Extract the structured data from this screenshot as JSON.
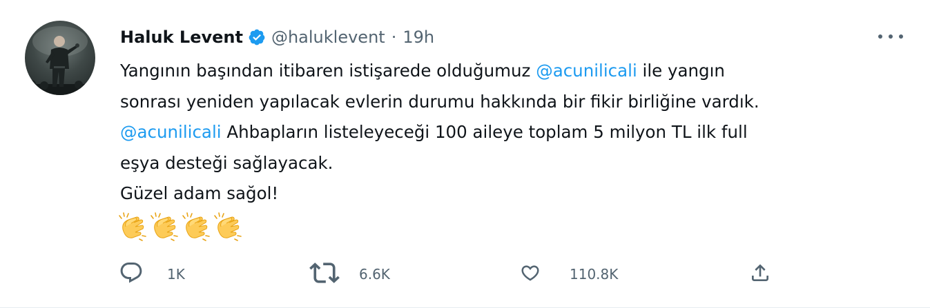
{
  "tweet": {
    "author": {
      "name": "Haluk Levent",
      "handle": "@haluklevent",
      "separator": "·",
      "time": "19h",
      "verified": true
    },
    "text": {
      "line1_pre": "Yangının başından itibaren istişarede olduğumuz  ",
      "mention1": "@acunilicali",
      "line1_post": " ile yangın",
      "line2": "sonrası yeniden yapılacak evlerin durumu hakkında bir fikir birliğine vardık.",
      "mention2": "@acunilicali",
      "line3_post": " Ahbapların listeleyeceği 100 aileye toplam 5 milyon TL ilk full",
      "line4": "eşya desteği sağlayacak.",
      "line5": "Güzel adam sağol!",
      "emojis": [
        "clapping-hands",
        "clapping-hands",
        "clapping-hands",
        "clapping-hands"
      ]
    },
    "actions": {
      "reply_count": "1K",
      "retweet_count": "6.6K",
      "like_count": "110.8K"
    },
    "colors": {
      "link": "#1d9bf0",
      "secondary": "#536471",
      "primary_text": "#0f1419",
      "verified": "#1d9bf0"
    }
  }
}
